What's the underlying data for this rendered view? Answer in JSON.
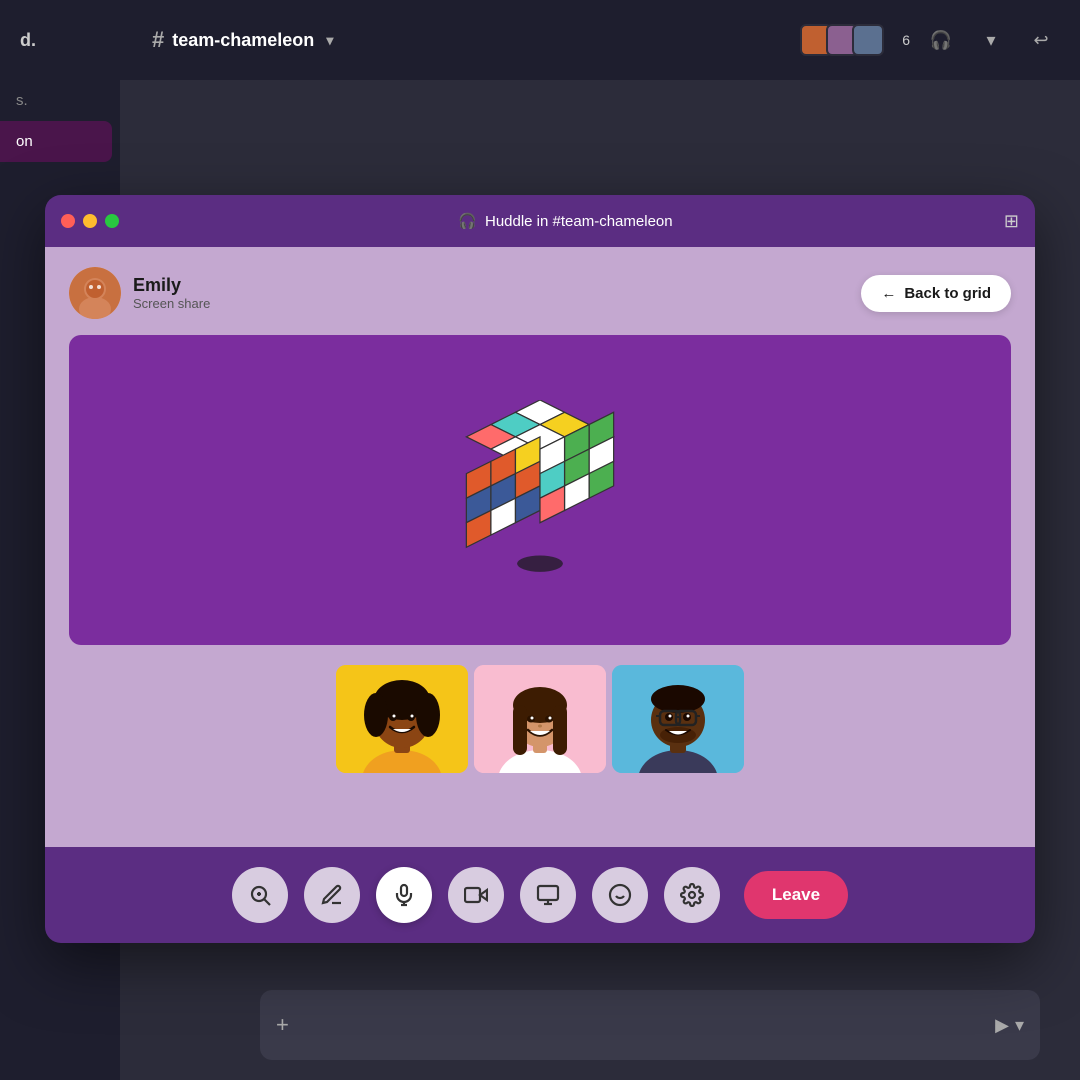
{
  "app": {
    "workspace": "d.",
    "channel": "team-chameleon",
    "member_count": "6"
  },
  "titlebar": {
    "title": "Huddle in #team-chameleon",
    "headphone_icon": "🎧"
  },
  "presenter": {
    "name": "Emily",
    "screen_share_label": "Screen share"
  },
  "back_to_grid": {
    "label": "Back to grid"
  },
  "controls": {
    "zoom_icon": "🔍",
    "draw_icon": "✏️",
    "mic_icon": "🎤",
    "video_icon": "📹",
    "screen_icon": "🖥",
    "emoji_icon": "😊",
    "settings_icon": "⚙️",
    "leave_label": "Leave"
  },
  "message_input": {
    "plus_icon": "+",
    "send_icon": "▶"
  },
  "sidebar": {
    "items": [
      {
        "label": "s.",
        "active": false
      },
      {
        "label": "on",
        "active": true
      }
    ]
  },
  "colors": {
    "huddle_bg": "#c4a8d0",
    "screen_share_bg": "#7b2d9e",
    "titlebar_bg": "#5b2d82",
    "control_bar_bg": "#5b2d82",
    "leave_btn": "#e0366e",
    "back_btn_bg": "#ffffff"
  }
}
